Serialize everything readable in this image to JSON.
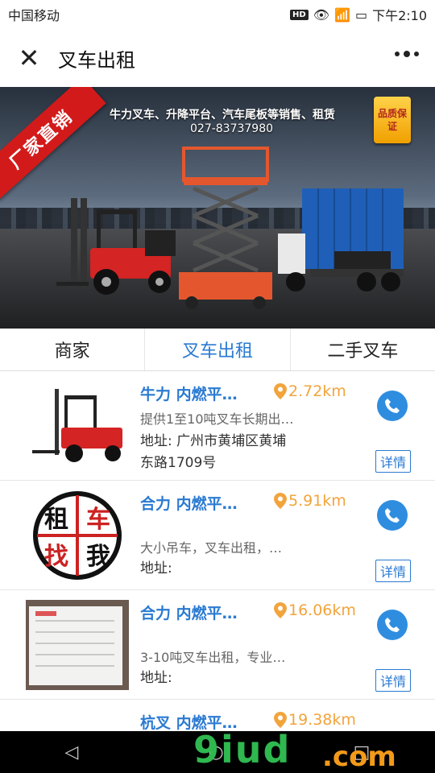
{
  "status": {
    "carrier": "中国移动",
    "time": "下午2:10",
    "hd": "HD"
  },
  "header": {
    "title": "叉车出租"
  },
  "banner": {
    "ribbon": "厂家直销",
    "headline": "牛力叉车、升降平台、汽车尾板等销售、租赁",
    "phone": "027-83737980",
    "badge": "品质保证"
  },
  "tabs": [
    {
      "label": "商家",
      "active": false
    },
    {
      "label": "叉车出租",
      "active": true
    },
    {
      "label": "二手叉车",
      "active": false
    }
  ],
  "items": [
    {
      "name": "牛力 内燃平…",
      "distance": "2.72km",
      "desc": "提供1至10吨叉车长期出…",
      "addr_label": "地址:",
      "addr_line1": "广州市黄埔区黄埔",
      "addr_line2": "东路1709号",
      "detail": "详情"
    },
    {
      "name": "合力 内燃平…",
      "distance": "5.91km",
      "desc": "大小吊车，叉车出租，…",
      "addr_label": "地址:",
      "addr_line1": "",
      "addr_line2": "",
      "detail": "详情",
      "thumb_text": [
        "租",
        "车",
        "找",
        "我"
      ]
    },
    {
      "name": "合力 内燃平…",
      "distance": "16.06km",
      "desc": "3-10吨叉车出租，专业…",
      "addr_label": "地址:",
      "addr_line1": "",
      "addr_line2": "",
      "detail": "详情"
    },
    {
      "name": "杭叉 内燃平…",
      "distance": "19.38km"
    }
  ],
  "watermark": {
    "main": "9iud",
    "suffix": ".com"
  },
  "colors": {
    "accent": "#2a7ad2",
    "distance": "#f2a43c",
    "call": "#2f8de0"
  }
}
